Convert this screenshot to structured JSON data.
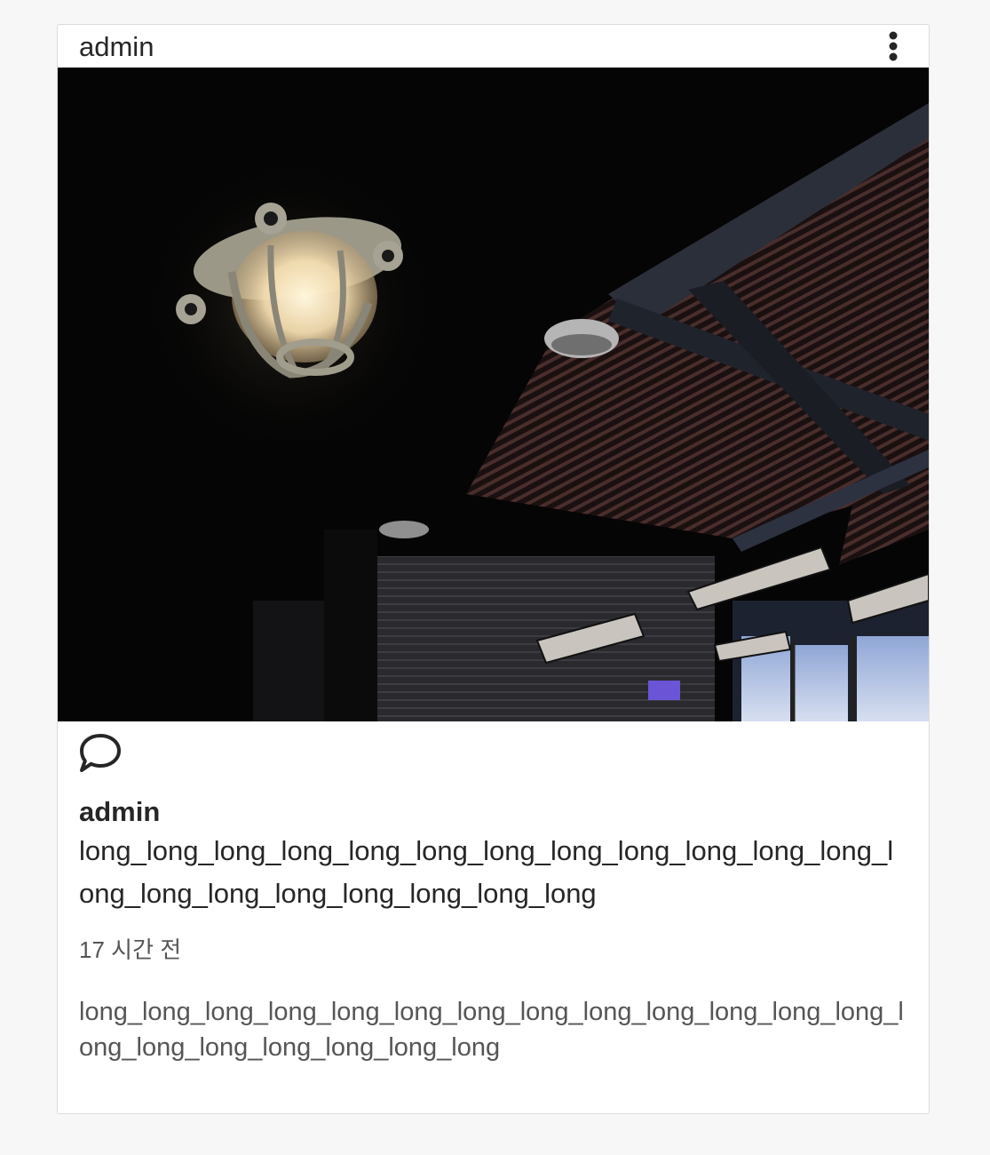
{
  "post": {
    "header_username": "admin",
    "more_icon": "more-vertical-icon",
    "image": "photo of ceiling lamp in dark industrial interior",
    "comment_icon": "comment-bubble-icon",
    "author": "admin",
    "title": "long_long_long_long_long_long_long_long_long_long_long_long_long_long_long_long_long_long_long_long",
    "time_ago": "17 시간 전",
    "description": "long_long_long_long_long_long_long_long_long_long_long_long_long_long_long_long_long_long_long_long"
  }
}
